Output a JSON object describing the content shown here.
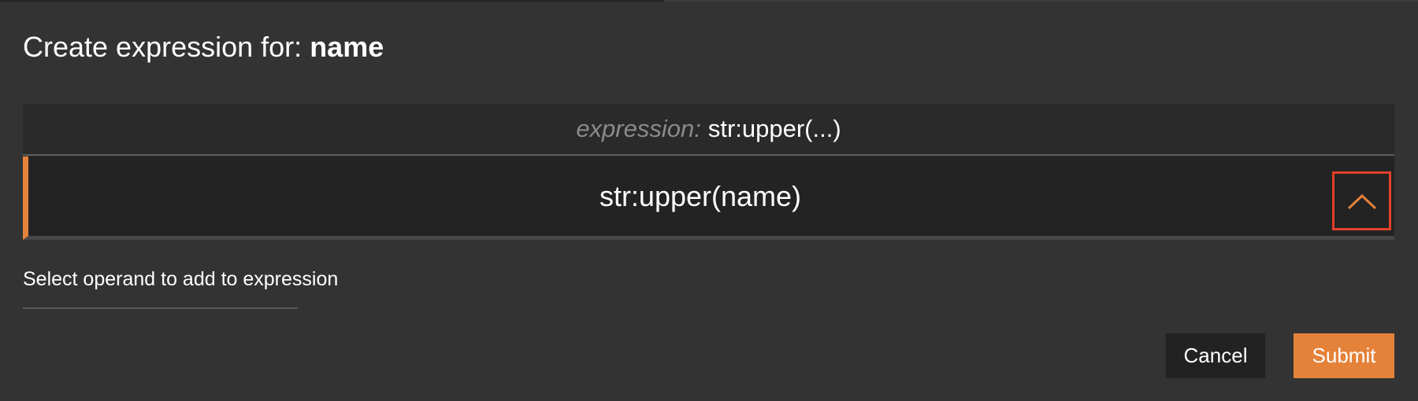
{
  "dialog": {
    "title_prefix": "Create expression for:",
    "title_field": "name"
  },
  "expression_header": {
    "prefix": "expression:",
    "value": "str:upper(...)"
  },
  "expression_panel": {
    "text": "str:upper(name)",
    "toggle_icon": "chevron-up-icon"
  },
  "operand": {
    "label": "Select operand to add to expression"
  },
  "actions": {
    "cancel_label": "Cancel",
    "submit_label": "Submit"
  },
  "colors": {
    "background": "#333333",
    "accent": "#e5823a",
    "focus_outline": "#e2402a",
    "panel": "#232323",
    "header": "#2a2a2a",
    "cancel_bg": "#222222",
    "muted_text": "#8a8a8a"
  }
}
